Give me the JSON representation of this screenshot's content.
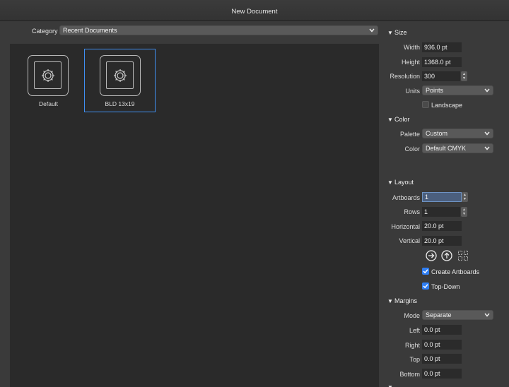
{
  "window": {
    "title": "New Document"
  },
  "category": {
    "label": "Category",
    "value": "Recent Documents"
  },
  "templates": [
    {
      "label": "Default",
      "selected": false
    },
    {
      "label": "BLD 13x19",
      "selected": true
    }
  ],
  "size": {
    "header": "Size",
    "width_label": "Width",
    "width_value": "936.0 pt",
    "height_label": "Height",
    "height_value": "1368.0 pt",
    "resolution_label": "Resolution",
    "resolution_value": "300",
    "units_label": "Units",
    "units_value": "Points",
    "landscape_label": "Landscape",
    "landscape_checked": false
  },
  "color": {
    "header": "Color",
    "palette_label": "Palette",
    "palette_value": "Custom",
    "color_label": "Color",
    "color_value": "Default CMYK"
  },
  "layout": {
    "header": "Layout",
    "artboards_label": "Artboards",
    "artboards_value": "1",
    "rows_label": "Rows",
    "rows_value": "1",
    "horizontal_label": "Horizontal",
    "horizontal_value": "20.0 pt",
    "vertical_label": "Vertical",
    "vertical_value": "20.0 pt",
    "create_artboards_label": "Create Artboards",
    "create_artboards_checked": true,
    "top_down_label": "Top-Down",
    "top_down_checked": true
  },
  "margins": {
    "header": "Margins",
    "mode_label": "Mode",
    "mode_value": "Separate",
    "left_label": "Left",
    "left_value": "0.0 pt",
    "right_label": "Right",
    "right_value": "0.0 pt",
    "top_label": "Top",
    "top_value": "0.0 pt",
    "bottom_label": "Bottom",
    "bottom_value": "0.0 pt"
  },
  "colors": {
    "accent": "#2f7ef3",
    "selection_border": "#3f8ef0"
  }
}
